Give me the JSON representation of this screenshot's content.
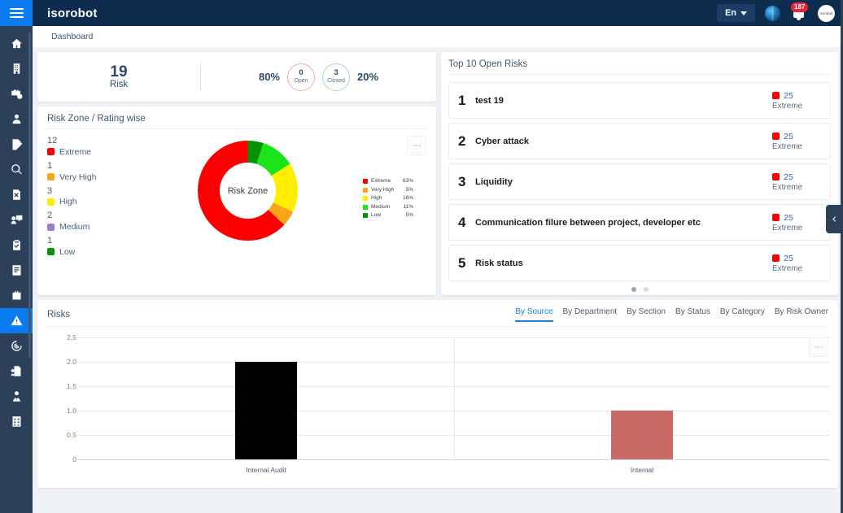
{
  "header": {
    "brand": "isorobot",
    "language": "En",
    "notification_count": "187",
    "avatar_text": "isorobot",
    "icons": {
      "menu": "hamburger-icon",
      "globe": "globe-icon",
      "bell": "bell-icon"
    }
  },
  "breadcrumb": {
    "text": "Dashboard"
  },
  "sidebar": {
    "items": [
      {
        "name": "home",
        "icon": "home-icon",
        "active": false
      },
      {
        "name": "organization",
        "icon": "building-icon",
        "active": false
      },
      {
        "name": "assets",
        "icon": "briefcase-clock-icon",
        "active": false
      },
      {
        "name": "users",
        "icon": "user-icon",
        "active": false
      },
      {
        "name": "assessments",
        "icon": "edit-document-icon",
        "active": false
      },
      {
        "name": "search",
        "icon": "search-icon",
        "active": false
      },
      {
        "name": "reports",
        "icon": "document-chart-icon",
        "active": false
      },
      {
        "name": "communication",
        "icon": "user-chat-icon",
        "active": false
      },
      {
        "name": "tasks",
        "icon": "clipboard-check-icon",
        "active": false
      },
      {
        "name": "documents",
        "icon": "notebook-icon",
        "active": false
      },
      {
        "name": "projects",
        "icon": "toolbox-icon",
        "active": false
      },
      {
        "name": "risk",
        "icon": "warning-triangle-icon",
        "active": true
      },
      {
        "name": "objectives",
        "icon": "target-icon",
        "active": false
      },
      {
        "name": "files",
        "icon": "file-share-icon",
        "active": false
      },
      {
        "name": "suppliers",
        "icon": "person-tie-icon",
        "active": false
      },
      {
        "name": "apps",
        "icon": "grid-icon",
        "active": false
      }
    ]
  },
  "stats": {
    "total_value": "19",
    "total_label": "Risk",
    "open_percent": "80%",
    "open_value": "0",
    "open_label": "Open",
    "closed_value": "3",
    "closed_label": "Closed",
    "closed_percent": "20%"
  },
  "risk_zone": {
    "title": "Risk Zone / Rating wise",
    "center_label": "Risk Zone",
    "counts": [
      {
        "count": "12",
        "label": "Extreme",
        "color": "#fb0000"
      },
      {
        "count": "1",
        "label": "Very High",
        "color": "#f8a618"
      },
      {
        "count": "3",
        "label": "High",
        "color": "#ffee00"
      },
      {
        "count": "2",
        "label": "Medium",
        "color": "#9b7ec9"
      },
      {
        "count": "1",
        "label": "Low",
        "color": "#069406"
      }
    ],
    "legend": [
      {
        "label": "Extreme",
        "percent": "63%",
        "color": "#fb0000"
      },
      {
        "label": "Very High",
        "percent": "5%",
        "color": "#f8a618"
      },
      {
        "label": "High",
        "percent": "16%",
        "color": "#ffee00"
      },
      {
        "label": "Medium",
        "percent": "11%",
        "color": "#1ae41a"
      },
      {
        "label": "Low",
        "percent": "5%",
        "color": "#069406"
      }
    ]
  },
  "top_risks": {
    "title": "Top 10 Open Risks",
    "items": [
      {
        "index": "1",
        "name": "test 19",
        "score": "25",
        "level": "Extreme"
      },
      {
        "index": "2",
        "name": "Cyber attack",
        "score": "25",
        "level": "Extreme"
      },
      {
        "index": "3",
        "name": "Liquidity",
        "score": "25",
        "level": "Extreme"
      },
      {
        "index": "4",
        "name": "Communication filure between project, developer etc",
        "score": "25",
        "level": "Extreme"
      },
      {
        "index": "5",
        "name": "Risk status",
        "score": "25",
        "level": "Extreme"
      }
    ],
    "pages": 2,
    "active_page": 1
  },
  "risks_panel": {
    "title": "Risks",
    "tabs": [
      {
        "label": "By Source",
        "active": true
      },
      {
        "label": "By Department",
        "active": false
      },
      {
        "label": "By Section",
        "active": false
      },
      {
        "label": "By Status",
        "active": false
      },
      {
        "label": "By Category",
        "active": false
      },
      {
        "label": "By Risk Owner",
        "active": false
      }
    ]
  },
  "chart_data": {
    "type": "bar",
    "title": "Risks",
    "xlabel": "",
    "ylabel": "",
    "categories": [
      "Internal Audit",
      "Internal"
    ],
    "values": [
      2.0,
      1.0
    ],
    "colors": [
      "#000000",
      "#c96a66"
    ],
    "ylim": [
      0,
      2.5
    ],
    "yticks": [
      "0",
      "0.5",
      "1.0",
      "1.5",
      "2.0",
      "2.5"
    ],
    "grid": true,
    "legend": "none"
  }
}
